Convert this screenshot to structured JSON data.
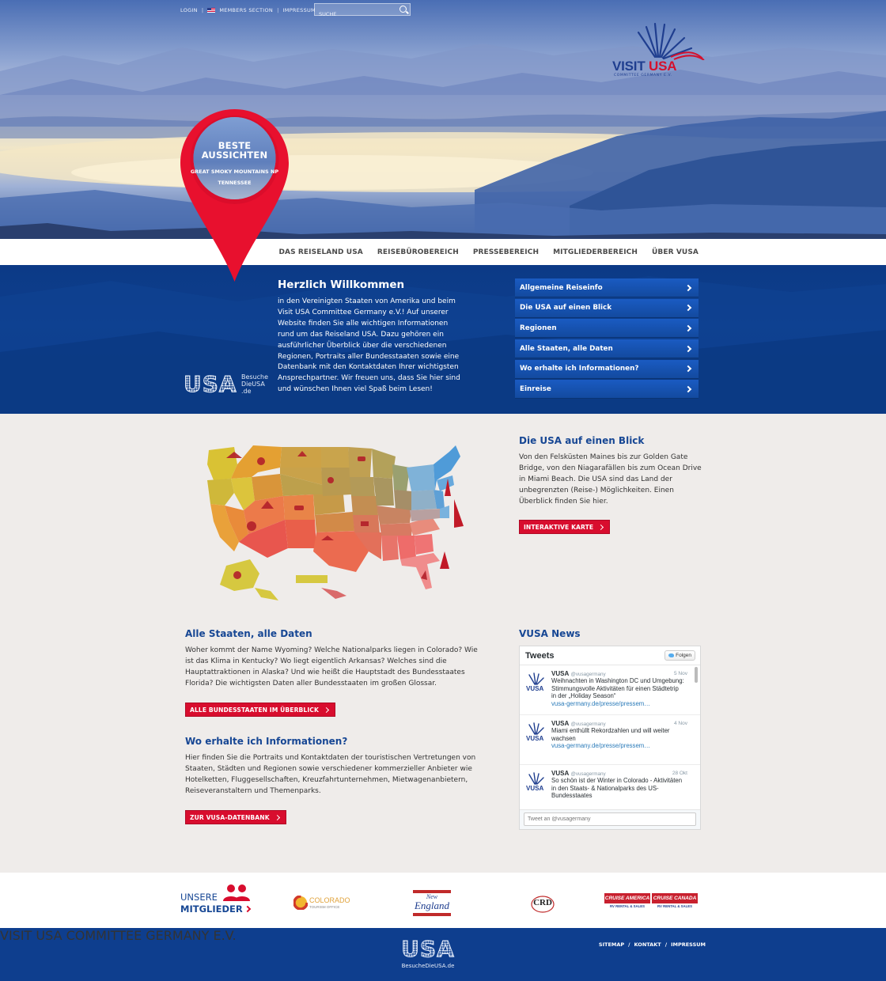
{
  "top": {
    "login": "LOGIN",
    "members_section": "MEMBERS SECTION",
    "impressum": "IMPRESSUM",
    "search_placeholder": "SUCHE"
  },
  "logo": {
    "visit": "VISIT ",
    "usa": "USA",
    "subtitle": "COMMITTEE GERMANY E.V."
  },
  "pin": {
    "title_line1": "BESTE",
    "title_line2": "AUSSICHTEN",
    "location_line1": "GREAT SMOKY MOUNTAINS NP",
    "location_line2": "TENNESSEE",
    "color": "#e8102e"
  },
  "nav": {
    "items": [
      "DAS REISELAND USA",
      "REISEBÜROBEREICH",
      "PRESSEBEREICH",
      "MITGLIEDERBEREICH",
      "ÜBER VUSA"
    ]
  },
  "welcome": {
    "title": "Herzlich Willkommen",
    "text": "in den Vereinigten Staaten von Amerika und beim Visit USA Committee Germany e.V.! Auf unserer Website finden Sie alle wichtigen Informationen rund um das Reiseland USA. Dazu gehören ein ausführlicher Überblick über die verschiedenen Regionen, Portraits aller Bundesstaaten sowie eine Datenbank mit den Kontaktdaten Ihrer wichtigsten Ansprechpartner. Wir freuen uns, dass Sie hier sind und wünschen Ihnen viel Spaß beim Lesen!",
    "usa_word": "USA",
    "besuche": "Besuche",
    "dieusa": "DieUSA",
    "de": ".de"
  },
  "sidemenu": {
    "items": [
      "Allgemeine Reiseinfo",
      "Die USA auf einen Blick",
      "Regionen",
      "Alle Staaten, alle Daten",
      "Wo erhalte ich Informationen?",
      "Einreise"
    ]
  },
  "overview": {
    "title": "Die USA auf einen Blick",
    "text": "Von den Felsküsten Maines bis zur Golden Gate Bridge, von den Niagarafällen bis zum Ocean Drive in Miami Beach. Die USA sind das Land der unbegrenzten (Reise-) Möglichkeiten. Einen Überblick finden Sie hier.",
    "button": "INTERAKTIVE KARTE"
  },
  "states": {
    "title": "Alle Staaten, alle Daten",
    "text": "Woher kommt der Name Wyoming? Welche Nationalparks liegen in Colorado? Wie ist das Klima in Kentucky? Wo liegt eigentlich Arkansas? Welches sind die Hauptattraktionen in Alaska? Und wie heißt die Hauptstadt des Bundesstaates Florida? Die wichtigsten Daten aller Bundesstaaten im großen Glossar.",
    "button": "ALLE BUNDESSTAATEN IM ÜBERBLICK"
  },
  "info": {
    "title": "Wo erhalte ich Informationen?",
    "text": "Hier finden Sie die Portraits und Kontaktdaten der touristischen Vertretungen von Staaten, Städten und Regionen sowie verschiedener kommerzieller Anbieter wie Hotelketten, Fluggesellschaften, Kreuzfahrtunternehmen, Mietwagenanbietern, Reiseveranstaltern und Themenparks.",
    "button": "ZUR VUSA-DATENBANK"
  },
  "news": {
    "title": "VUSA News",
    "widget_title": "Tweets",
    "follow": "Folgen",
    "compose_placeholder": "Tweet an @vusagermany",
    "tweets": [
      {
        "name": "VUSA",
        "handle": "@vusagermany",
        "date": "5 Nov",
        "body": "Weihnachten in Washington DC und Umgebung: Stimmungsvolle Aktivitäten für einen Städtetrip in der „Holiday Season“",
        "link": "vusa-germany.de/presse/pressem…"
      },
      {
        "name": "VUSA",
        "handle": "@vusagermany",
        "date": "4 Nov",
        "body": "Miami enthüllt Rekordzahlen und will weiter wachsen",
        "link": "vusa-germany.de/presse/pressem…"
      },
      {
        "name": "VUSA",
        "handle": "@vusagermany",
        "date": "28 Okt",
        "body": "So schön ist der Winter in Colorado - Aktivitäten in den Staats- & Nationalparks des US-Bundesstaates",
        "link": ""
      }
    ]
  },
  "members": {
    "line1": "UNSERE",
    "line2": "MITGLIEDER",
    "colorado": "COLORADO",
    "colorado_sub": "TOURISM OFFICE",
    "ne_new": "New",
    "ne_england": "England",
    "crd": "CRD",
    "cruise_america": "CRUISE AMERICA",
    "cruise_canada": "CRUISE CANADA",
    "rv_sales": "RV RENTAL & SALES"
  },
  "footer": {
    "org": "VISIT USA COMMITTEE GERMANY E.V.",
    "usa_word": "USA",
    "domain": "BesucheDieUSA.de",
    "links": [
      "SITEMAP",
      "KONTAKT",
      "IMPRESSUM"
    ]
  }
}
